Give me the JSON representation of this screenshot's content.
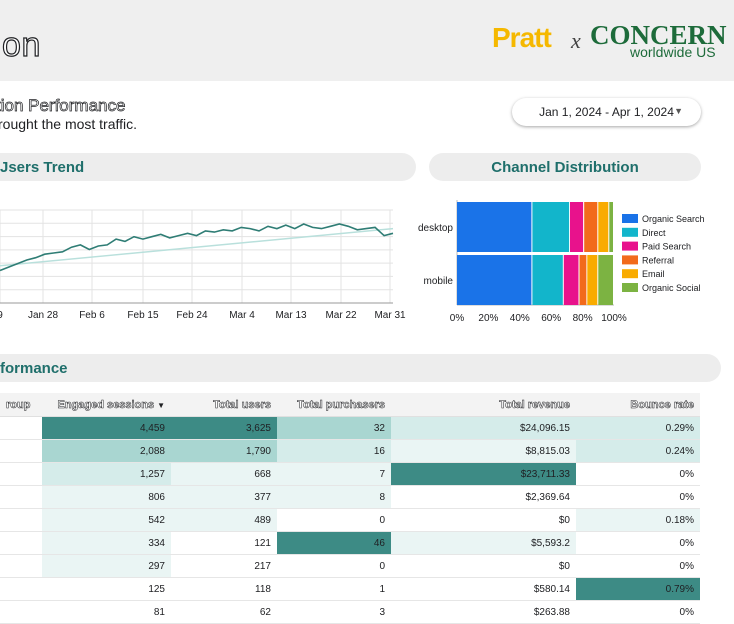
{
  "header": {
    "title": "ion",
    "logo": {
      "part1": "Pratt",
      "separator": "x",
      "part2": "CONCERN",
      "part3": "worldwide US"
    }
  },
  "subtitle": {
    "line1": "tion Performance",
    "line2": "rought the most traffic."
  },
  "date_range": {
    "label": "Jan 1, 2024 - Apr 1, 2024"
  },
  "sections": {
    "trend": "Jsers Trend",
    "channel": "Channel Distribution",
    "performance": "formance"
  },
  "colors": {
    "teal_dark": "#3d8b85",
    "teal_mid": "#6fb5ae",
    "teal_light": "#a9d6d1",
    "teal_pale": "#d5ecea",
    "teal_faint": "#eaf5f4"
  },
  "chart_data": [
    {
      "type": "line",
      "x_tick_labels": [
        "9",
        "Jan 28",
        "Feb 6",
        "Feb 15",
        "Feb 24",
        "Mar 4",
        "Mar 13",
        "Mar 22",
        "Mar 31"
      ],
      "series": [
        {
          "values": [
            68,
            71,
            74,
            77,
            79,
            82,
            83,
            84,
            88,
            90,
            86,
            89,
            90,
            95,
            93,
            97,
            95,
            97,
            99,
            96,
            98,
            100,
            98,
            102,
            101,
            103,
            102,
            105,
            104,
            102,
            106,
            104,
            107,
            104,
            108,
            105,
            104,
            106,
            108,
            106,
            103,
            104,
            105,
            98,
            100
          ]
        },
        {
          "values": [
            72,
            104
          ]
        }
      ],
      "grid": true
    },
    {
      "type": "bar",
      "orientation": "horizontal",
      "stacked": true,
      "categories": [
        "desktop",
        "mobile"
      ],
      "x_tick_labels": [
        "0%",
        "20%",
        "40%",
        "60%",
        "80%",
        "100%"
      ],
      "xlim": [
        0,
        100
      ],
      "series": [
        {
          "name": "Organic Search",
          "color": "#1a73e8",
          "values": [
            48,
            48
          ]
        },
        {
          "name": "Direct",
          "color": "#12b5cb",
          "values": [
            24,
            20
          ]
        },
        {
          "name": "Paid Search",
          "color": "#e8128c",
          "values": [
            9,
            10
          ]
        },
        {
          "name": "Referral",
          "color": "#f26a1b",
          "values": [
            9,
            5
          ]
        },
        {
          "name": "Email",
          "color": "#f9ab00",
          "values": [
            7,
            7
          ]
        },
        {
          "name": "Organic Social",
          "color": "#7cb342",
          "values": [
            3,
            10
          ]
        }
      ],
      "legend_position": "right"
    }
  ],
  "table": {
    "columns": [
      "roup",
      "Engaged sessions",
      "Total users",
      "Total purchasers",
      "Total revenue",
      "Bounce rate"
    ],
    "rows": [
      {
        "cells": [
          "",
          "4,459",
          "3,625",
          "32",
          "$24,096.15",
          "0.29%"
        ],
        "shades": [
          0,
          4,
          4,
          3,
          2,
          2
        ]
      },
      {
        "cells": [
          "",
          "2,088",
          "1,790",
          "16",
          "$8,815.03",
          "0.24%"
        ],
        "shades": [
          0,
          3,
          3,
          2,
          1,
          2
        ]
      },
      {
        "cells": [
          "",
          "1,257",
          "668",
          "7",
          "$23,711.33",
          "0%"
        ],
        "shades": [
          0,
          2,
          1,
          1,
          4,
          0
        ]
      },
      {
        "cells": [
          "",
          "806",
          "377",
          "8",
          "$2,369.64",
          "0%"
        ],
        "shades": [
          0,
          1,
          1,
          1,
          0,
          0
        ]
      },
      {
        "cells": [
          "",
          "542",
          "489",
          "0",
          "$0",
          "0.18%"
        ],
        "shades": [
          0,
          1,
          1,
          0,
          0,
          1
        ]
      },
      {
        "cells": [
          "",
          "334",
          "121",
          "46",
          "$5,593.2",
          "0%"
        ],
        "shades": [
          0,
          1,
          0,
          4,
          1,
          0
        ]
      },
      {
        "cells": [
          "",
          "297",
          "217",
          "0",
          "$0",
          "0%"
        ],
        "shades": [
          0,
          1,
          0,
          0,
          0,
          0
        ]
      },
      {
        "cells": [
          "",
          "125",
          "118",
          "1",
          "$580.14",
          "0.79%"
        ],
        "shades": [
          0,
          0,
          0,
          0,
          0,
          4
        ]
      },
      {
        "cells": [
          "",
          "81",
          "62",
          "3",
          "$263.88",
          "0%"
        ],
        "shades": [
          0,
          0,
          0,
          0,
          0,
          0
        ]
      }
    ]
  }
}
